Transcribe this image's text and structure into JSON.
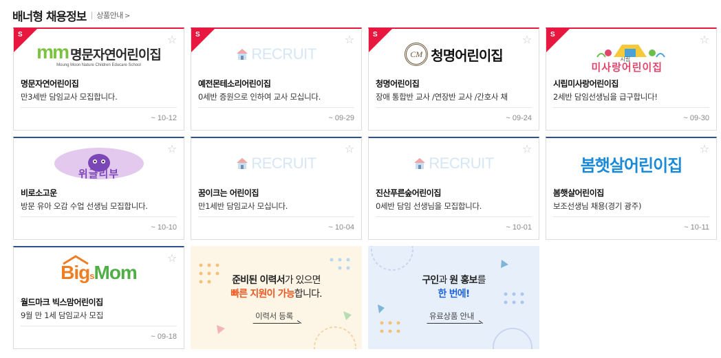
{
  "header": {
    "title": "배너형 채용정보",
    "link_label": "상품안내",
    "link_chevron": ">"
  },
  "colors": {
    "premium_accent": "#e8173f",
    "standard_accent": "#2d4f8e",
    "star": "#c8c8c8"
  },
  "cards": [
    {
      "tier": "premium",
      "badge": "S",
      "logo": {
        "type": "mm",
        "mark": "mm",
        "text": "명문자연어린이집",
        "sub": "Moung Moon Nature Children Educare School"
      },
      "name": "명문자연어린이집",
      "desc": "만3세반 담임교사 모집합니다.",
      "date": "~ 10-12"
    },
    {
      "tier": "premium",
      "badge": "S",
      "logo": {
        "type": "recruit",
        "text": "RECRUIT"
      },
      "name": "예전몬테소리어린이집",
      "desc": "0세반 증원으로 인하여 교사 모십니다.",
      "date": "~ 09-29"
    },
    {
      "tier": "premium",
      "badge": "S",
      "logo": {
        "type": "cm",
        "mark": "CM",
        "text": "청명어린이집"
      },
      "name": "청명어린이집",
      "desc": "장애 통합반 교사 /연장반 교사 /간호사 채",
      "date": "~ 09-24"
    },
    {
      "tier": "premium",
      "badge": "S",
      "logo": {
        "type": "sirip",
        "text": "미사랑어린이집",
        "small": "시립"
      },
      "name": "시립미사랑어린이집",
      "desc": "2세반 담임선생님을 급구합니다!",
      "date": "~ 09-30"
    },
    {
      "tier": "standard",
      "logo": {
        "type": "wigle",
        "text": "위글리부"
      },
      "name": "비로소고운",
      "desc": "방문 유아 오감 수업 선생님 모집합니다.",
      "date": "~ 10-10"
    },
    {
      "tier": "standard",
      "logo": {
        "type": "recruit",
        "text": "RECRUIT"
      },
      "name": "꿈이크는 어린이집",
      "desc": "만1세반 담임교사 모십니다.",
      "date": "~ 10-04"
    },
    {
      "tier": "standard",
      "logo": {
        "type": "recruit",
        "text": "RECRUIT"
      },
      "name": "진산푸른숲어린이집",
      "desc": "0세반 담임 선생님을 모집합니다.",
      "date": "~ 10-01"
    },
    {
      "tier": "standard",
      "logo": {
        "type": "bom",
        "text": "봄햇살어린이집"
      },
      "name": "봄햇살어린이집",
      "desc": "보조선생님 채용(경기 광주)",
      "date": "~ 10-11"
    },
    {
      "tier": "standard",
      "logo": {
        "type": "bigmom",
        "big": "Big",
        "s": "s",
        "mom": "Mom"
      },
      "name": "월드마크 빅스맘어린이집",
      "desc": "9월 만 1세 담임교사 모집",
      "date": "~ 09-18"
    }
  ],
  "promos": [
    {
      "line1_a": "준비된 ",
      "line1_b": "이력서",
      "line1_c": "가 있으면",
      "line2_a": "빠른 지원이 가능",
      "line2_b": "합니다.",
      "button": "이력서 등록"
    },
    {
      "line1_a": "구인",
      "line1_b": "과 ",
      "line1_c": "원 홍보",
      "line1_d": "를",
      "line2_a": "한 번에!",
      "button": "유료상품 안내"
    }
  ],
  "icons": {
    "star": "star-outline-icon",
    "house": "house-icon"
  }
}
